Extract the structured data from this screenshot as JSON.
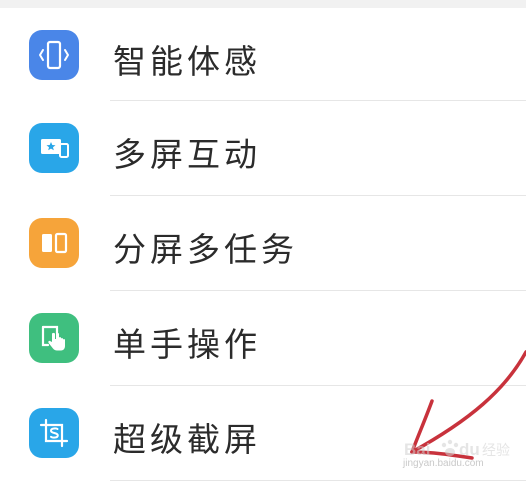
{
  "settings": {
    "items": [
      {
        "label": "智能体感",
        "icon": "phone-rotate-icon",
        "color": "#4a86e8"
      },
      {
        "label": "多屏互动",
        "icon": "multi-screen-icon",
        "color": "#29a6e8"
      },
      {
        "label": "分屏多任务",
        "icon": "split-screen-icon",
        "color": "#f6a43a"
      },
      {
        "label": "单手操作",
        "icon": "one-hand-icon",
        "color": "#3fbf7f"
      },
      {
        "label": "超级截屏",
        "icon": "screenshot-icon",
        "color": "#29a6e8"
      }
    ]
  },
  "watermark": {
    "text": "jingyan.baidu.com"
  }
}
